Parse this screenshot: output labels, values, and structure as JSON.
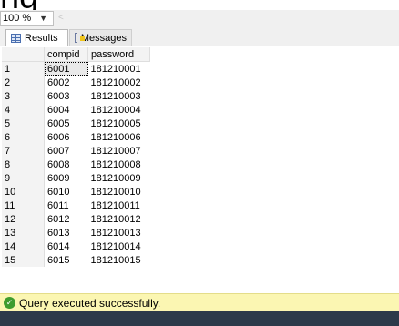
{
  "header": {
    "top_text": "ng"
  },
  "zoom": {
    "value": "100 %"
  },
  "tabs": {
    "results_label": "Results",
    "messages_label": "Messages"
  },
  "grid": {
    "columns": [
      "compid",
      "password"
    ],
    "rows": [
      {
        "num": "1",
        "compid": "6001",
        "password": "181210001"
      },
      {
        "num": "2",
        "compid": "6002",
        "password": "181210002"
      },
      {
        "num": "3",
        "compid": "6003",
        "password": "181210003"
      },
      {
        "num": "4",
        "compid": "6004",
        "password": "181210004"
      },
      {
        "num": "5",
        "compid": "6005",
        "password": "181210005"
      },
      {
        "num": "6",
        "compid": "6006",
        "password": "181210006"
      },
      {
        "num": "7",
        "compid": "6007",
        "password": "181210007"
      },
      {
        "num": "8",
        "compid": "6008",
        "password": "181210008"
      },
      {
        "num": "9",
        "compid": "6009",
        "password": "181210009"
      },
      {
        "num": "10",
        "compid": "6010",
        "password": "181210010"
      },
      {
        "num": "11",
        "compid": "6011",
        "password": "181210011"
      },
      {
        "num": "12",
        "compid": "6012",
        "password": "181210012"
      },
      {
        "num": "13",
        "compid": "6013",
        "password": "181210013"
      },
      {
        "num": "14",
        "compid": "6014",
        "password": "181210014"
      },
      {
        "num": "15",
        "compid": "6015",
        "password": "181210015"
      }
    ]
  },
  "status": {
    "message": "Query executed successfully.",
    "icon": "success-check-icon",
    "color": "#fbf6b2"
  }
}
